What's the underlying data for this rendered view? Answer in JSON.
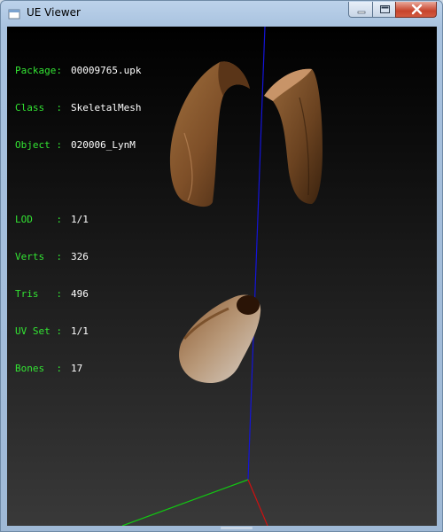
{
  "window": {
    "title": "UE Viewer"
  },
  "info": {
    "package_label": "Package:",
    "package_value": "00009765.upk",
    "class_label": "Class  :",
    "class_value": "SkeletalMesh",
    "object_label": "Object :",
    "object_value": "020006_LynM",
    "lod_label": "LOD    :",
    "lod_value": "1/1",
    "verts_label": "Verts  :",
    "verts_value": "326",
    "tris_label": "Tris   :",
    "tris_value": "496",
    "uvset_label": "UV Set :",
    "uvset_value": "1/1",
    "bones_label": "Bones  :",
    "bones_value": "17"
  },
  "colors": {
    "label_green": "#33e533",
    "value_white": "#ffffff",
    "axis_x": "#d01010",
    "axis_y": "#10d010",
    "axis_z": "#1010e0",
    "fur_brown": "#8a5a30"
  },
  "icons": {
    "app": "ue-viewer-app-icon",
    "minimize": "minimize-icon",
    "maximize": "maximize-icon",
    "close": "close-icon"
  }
}
